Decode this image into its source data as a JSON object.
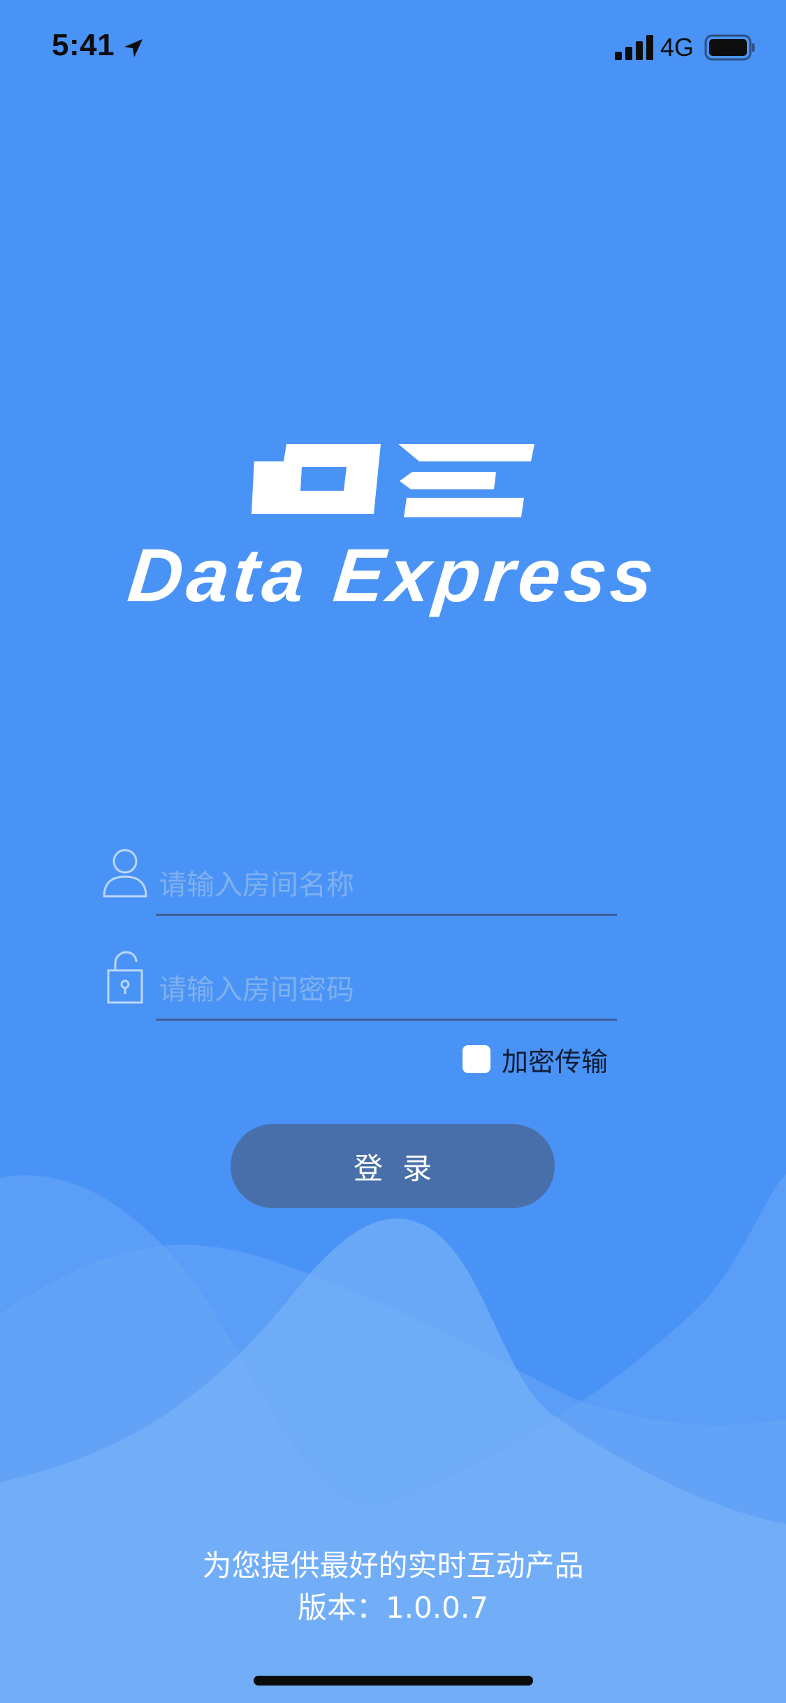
{
  "status_bar": {
    "time": "5:41",
    "network": "4G",
    "icons": [
      "location-arrow-icon",
      "signal-icon",
      "battery-icon"
    ]
  },
  "logo": {
    "mark": "DE",
    "name": "Data Express"
  },
  "form": {
    "room_name": {
      "placeholder": "请输入房间名称",
      "value": ""
    },
    "room_password": {
      "placeholder": "请输入房间密码",
      "value": ""
    },
    "encrypt": {
      "label": "加密传输",
      "checked": false
    },
    "login_label": "登录"
  },
  "footer": {
    "tagline": "为您提供最好的实时互动产品",
    "version": "版本：1.0.0.7"
  },
  "colors": {
    "background": "#4a93f6",
    "button": "#486fa9",
    "placeholder": "#7fb0ef"
  }
}
